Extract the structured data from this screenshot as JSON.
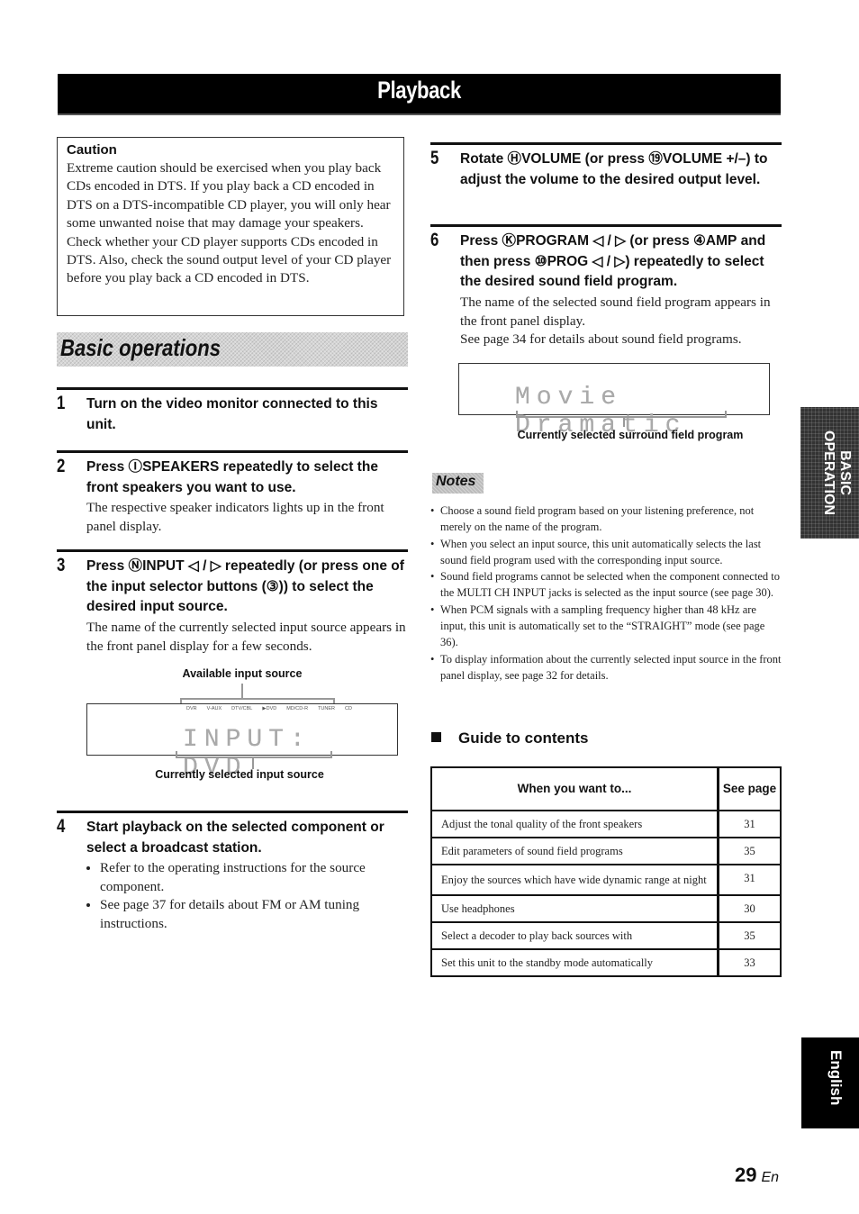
{
  "banner": {
    "title": "Playback"
  },
  "caution": {
    "title": "Caution",
    "text": "Extreme caution should be exercised when you play back CDs encoded in DTS. If you play back a CD encoded in DTS on a DTS-incompatible CD player, you will only hear some unwanted noise that may damage your speakers. Check whether your CD player supports CDs encoded in DTS. Also, check the sound output level of your CD player before you play back a CD encoded in DTS."
  },
  "section": {
    "title": "Basic operations"
  },
  "steps": [
    {
      "num": "1",
      "title": "Turn on the video monitor connected to this unit."
    },
    {
      "num": "2",
      "title_pre": "Press ",
      "button_ref": "Ⓘ",
      "button_label": "SPEAKERS",
      "title_post": " repeatedly to select the front speakers you want to use.",
      "body": "The respective speaker indicators lights up in the front panel display."
    },
    {
      "num": "3",
      "title_pre": "Press ",
      "button_ref": "Ⓝ",
      "button_label": "INPUT",
      "title_post": " ◁ / ▷ repeatedly (or press one of the input selector buttons (③)) to select the desired input source.",
      "body": "The name of the currently selected input source appears in the front panel display for a few seconds."
    },
    {
      "num": "4",
      "title": "Start playback on the selected component or select a broadcast station.",
      "bullets": [
        "Refer to the operating instructions for the source component.",
        "See page 37 for details about FM or AM tuning instructions."
      ]
    },
    {
      "num": "5",
      "title_pre": "Rotate ",
      "button_ref": "Ⓗ",
      "button_label": "VOLUME",
      "title_mid": " (or press ⑲",
      "button_label2": "VOLUME",
      "title_post": " +/–) to adjust the volume to the desired output level."
    },
    {
      "num": "6",
      "title_pre": "Press ",
      "button_ref": "Ⓚ",
      "button_label": "PROGRAM",
      "title_mid": " ◁ / ▷ (or press ④",
      "button_label2": "AMP",
      "title_mid2": " and then press ⑩",
      "button_label3": "PROG",
      "title_post": " ◁ / ▷) repeatedly to select the desired sound field program.",
      "body1": "The name of the selected sound field program appears in the front panel display.",
      "body2": "See page 34 for details about sound field programs."
    }
  ],
  "input_display": {
    "top_caption": "Available input source",
    "sources": [
      "DVR",
      "V-AUX",
      "DTV/CBL",
      "▶DVD",
      "MD/CD-R",
      "TUNER",
      "CD"
    ],
    "text": "INPUT: DVD",
    "bottom_caption": "Currently selected input source"
  },
  "program_display": {
    "text": "Movie Dramatic",
    "caption": "Currently selected surround field program"
  },
  "notes": {
    "label": "Notes",
    "items": [
      "Choose a sound field program based on your listening preference, not merely on the name of the program.",
      "When you select an input source, this unit automatically selects the last sound field program used with the corresponding input source.",
      "Sound field programs cannot be selected when the component connected to the MULTI CH INPUT jacks is selected as the input source (see page 30).",
      "When PCM signals with a sampling frequency higher than 48 kHz are input, this unit is automatically set to the “STRAIGHT” mode (see page 36).",
      "To display information about the currently selected input source in the front panel display, see page 32 for details."
    ]
  },
  "guide": {
    "title": "Guide to contents",
    "col_task": "When you want to...",
    "col_page": "See page",
    "rows": [
      {
        "task": "Adjust the tonal quality of the front speakers",
        "page": "31"
      },
      {
        "task": "Edit parameters of sound field programs",
        "page": "35"
      },
      {
        "task": "Enjoy the sources which have wide dynamic range at night",
        "page": "31"
      },
      {
        "task": "Use headphones",
        "page": "30"
      },
      {
        "task": "Select a decoder to play back sources with",
        "page": "35"
      },
      {
        "task": "Set this unit to the standby mode automatically",
        "page": "33"
      }
    ]
  },
  "side_tabs": {
    "section_line1": "BASIC",
    "section_line2": "OPERATION",
    "language": "English"
  },
  "footer": {
    "page_number": "29",
    "lang_code": "En"
  }
}
